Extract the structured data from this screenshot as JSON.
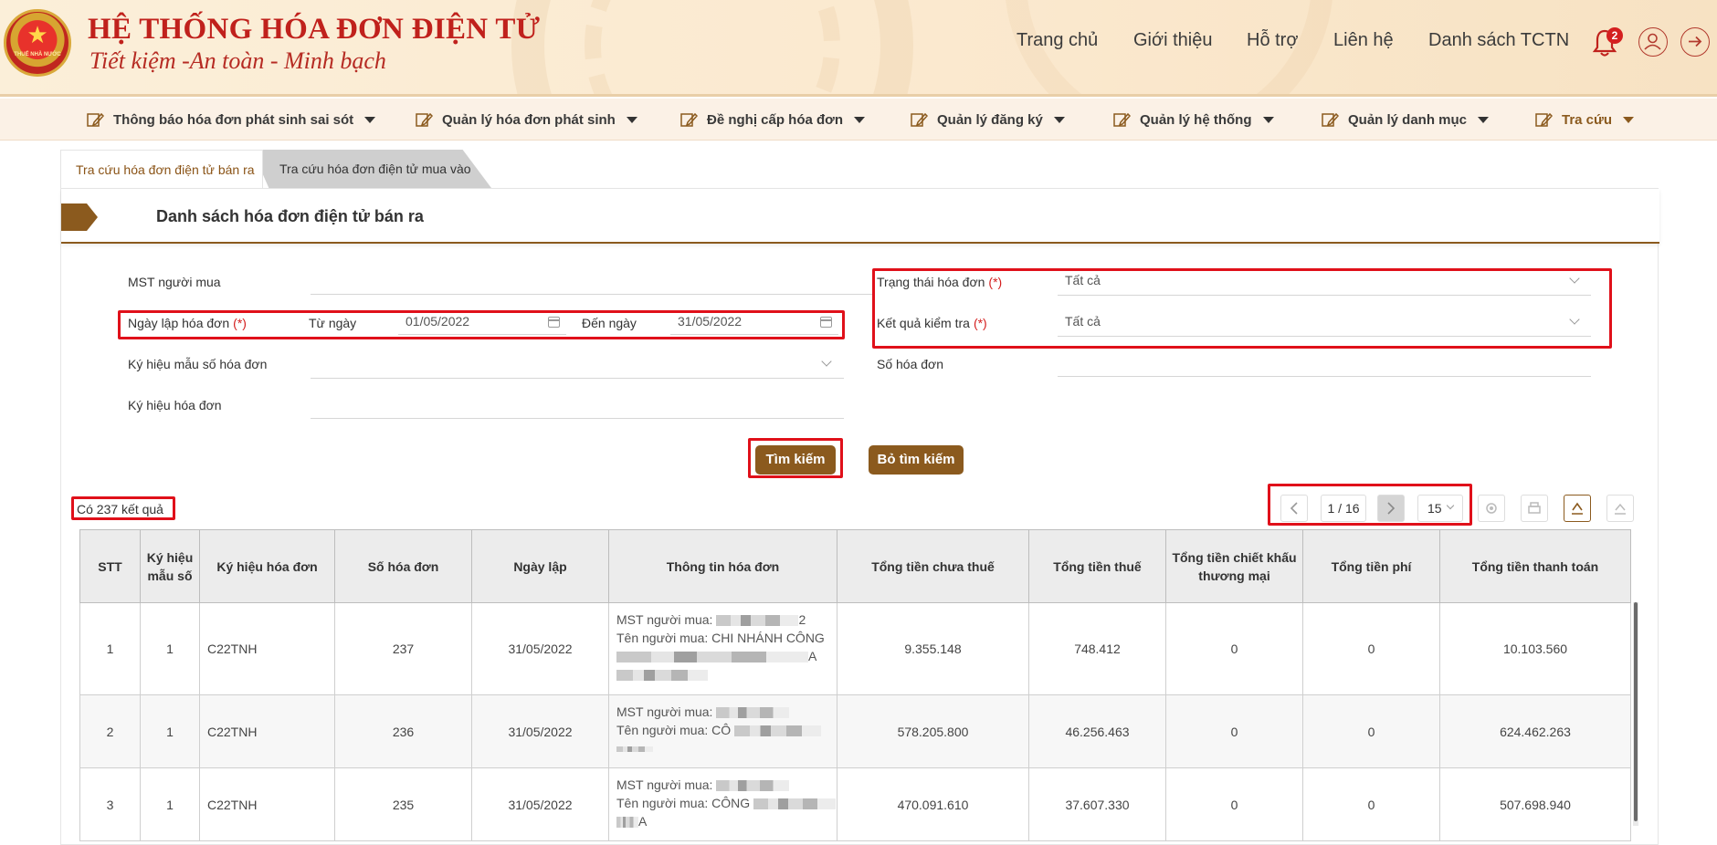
{
  "header": {
    "title": "HỆ THỐNG HÓA ĐƠN ĐIỆN TỬ",
    "subtitle": "Tiết kiệm -An toàn - Minh bạch",
    "logo_text": "THUẾ NHÀ NƯỚC",
    "nav": [
      "Trang chủ",
      "Giới thiệu",
      "Hỗ trợ",
      "Liên hệ",
      "Danh sách TCTN"
    ],
    "notification_count": "2",
    "brand_color": "#c0211c",
    "accent_color": "#8b5a1e"
  },
  "menu": [
    {
      "label": "Thông báo hóa đơn phát sinh sai sót",
      "icon": "edit-icon"
    },
    {
      "label": "Quản lý hóa đơn phát sinh",
      "icon": "edit-icon"
    },
    {
      "label": "Đề nghị cấp hóa đơn",
      "icon": "edit-icon"
    },
    {
      "label": "Quản lý đăng ký",
      "icon": "edit-icon"
    },
    {
      "label": "Quản lý hệ thống",
      "icon": "edit-icon"
    },
    {
      "label": "Quản lý danh mục",
      "icon": "edit-icon"
    },
    {
      "label": "Tra cứu",
      "icon": "edit-icon"
    }
  ],
  "tabs": [
    "Tra cứu hóa đơn điện tử bán ra",
    "Tra cứu hóa đơn điện tử mua vào"
  ],
  "panel": {
    "title": "Danh sách hóa đơn điện tử bán ra"
  },
  "form": {
    "buyer_tax_label": "MST người mua",
    "date_label": "Ngày lập hóa đơn",
    "required_mark": "(*)",
    "from_label": "Từ ngày",
    "from_value": "01/05/2022",
    "to_label": "Đến ngày",
    "to_value": "31/05/2022",
    "template_label": "Ký hiệu mẫu số hóa đơn",
    "symbol_label": "Ký hiệu hóa đơn",
    "status_label": "Trạng thái hóa đơn",
    "status_value": "Tất cả",
    "check_label": "Kết quả kiểm tra",
    "check_value": "Tất cả",
    "number_label": "Số hóa đơn",
    "search_button": "Tìm kiếm",
    "clear_button": "Bỏ tìm kiếm"
  },
  "results": {
    "text": "Có 237 kết quả"
  },
  "pagination": {
    "page": "1 / 16",
    "page_size": "15"
  },
  "table": {
    "headers": [
      "STT",
      "Ký hiệu mẫu số",
      "Ký hiệu hóa đơn",
      "Số hóa đơn",
      "Ngày lập",
      "Thông tin hóa đơn",
      "Tổng tiền chưa thuế",
      "Tổng tiền thuế",
      "Tổng tiền chiết khấu thương mại",
      "Tổng tiền phí",
      "Tổng tiền thanh toán"
    ],
    "buyer_tax_prefix": "MST người mua:",
    "buyer_name_prefix": "Tên người mua:",
    "rows": [
      {
        "stt": "1",
        "template": "1",
        "symbol": "C22TNH",
        "number": "237",
        "date": "31/05/2022",
        "buyer_tax_tail": "2",
        "buyer_name": "CHI NHÁNH CÔNG",
        "buyer_extra": "A",
        "pre_tax": "9.355.148",
        "tax": "748.412",
        "discount": "0",
        "fee": "0",
        "total": "10.103.560"
      },
      {
        "stt": "2",
        "template": "1",
        "symbol": "C22TNH",
        "number": "236",
        "date": "31/05/2022",
        "buyer_tax_tail": "",
        "buyer_name": "CÔ",
        "buyer_extra": "",
        "pre_tax": "578.205.800",
        "tax": "46.256.463",
        "discount": "0",
        "fee": "0",
        "total": "624.462.263"
      },
      {
        "stt": "3",
        "template": "1",
        "symbol": "C22TNH",
        "number": "235",
        "date": "31/05/2022",
        "buyer_tax_tail": "",
        "buyer_name": "CÔNG",
        "buyer_extra": "A",
        "pre_tax": "470.091.610",
        "tax": "37.607.330",
        "discount": "0",
        "fee": "0",
        "total": "507.698.940"
      }
    ]
  }
}
